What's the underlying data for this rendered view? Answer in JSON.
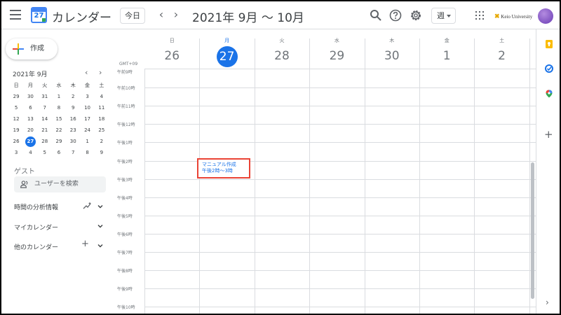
{
  "header": {
    "app_title": "カレンダー",
    "logo_day": "27",
    "today_label": "今日",
    "prev": "‹",
    "next": "›",
    "date_range": "2021年 9月 ～ 10月",
    "view_label": "週",
    "org_name": "Keio University"
  },
  "sidebar": {
    "create_label": "作成",
    "mini_title": "2021年 9月",
    "weekdays": [
      "日",
      "月",
      "火",
      "水",
      "木",
      "金",
      "土"
    ],
    "weeks": [
      [
        "29",
        "30",
        "31",
        "1",
        "2",
        "3",
        "4"
      ],
      [
        "5",
        "6",
        "7",
        "8",
        "9",
        "10",
        "11"
      ],
      [
        "12",
        "13",
        "14",
        "15",
        "16",
        "17",
        "18"
      ],
      [
        "19",
        "20",
        "21",
        "22",
        "23",
        "24",
        "25"
      ],
      [
        "26",
        "27",
        "28",
        "29",
        "30",
        "1",
        "2"
      ],
      [
        "3",
        "4",
        "5",
        "6",
        "7",
        "8",
        "9"
      ]
    ],
    "selected_day": "27",
    "guest_label": "ゲスト",
    "search_users_placeholder": "ユーザーを検索",
    "time_insights": "時間の分析情報",
    "my_calendars": "マイカレンダー",
    "other_calendars": "他のカレンダー"
  },
  "calendar": {
    "timezone": "GMT+09",
    "days": [
      {
        "dow": "日",
        "num": "26"
      },
      {
        "dow": "月",
        "num": "27",
        "today": true
      },
      {
        "dow": "火",
        "num": "28"
      },
      {
        "dow": "水",
        "num": "29"
      },
      {
        "dow": "木",
        "num": "30"
      },
      {
        "dow": "金",
        "num": "1"
      },
      {
        "dow": "土",
        "num": "2"
      }
    ],
    "hours": [
      "午前9時",
      "午前10時",
      "午前11時",
      "午後12時",
      "午後1時",
      "午後2時",
      "午後3時",
      "午後4時",
      "午後5時",
      "午後6時",
      "午後7時",
      "午後8時",
      "午後9時",
      "午後10時"
    ],
    "event": {
      "title": "マニュアル作成",
      "time": "午後2時～3時",
      "color": "#1a73e8",
      "highlight": "#ea4335"
    }
  },
  "colors": {
    "accent": "#1a73e8",
    "border": "#dadce0"
  }
}
